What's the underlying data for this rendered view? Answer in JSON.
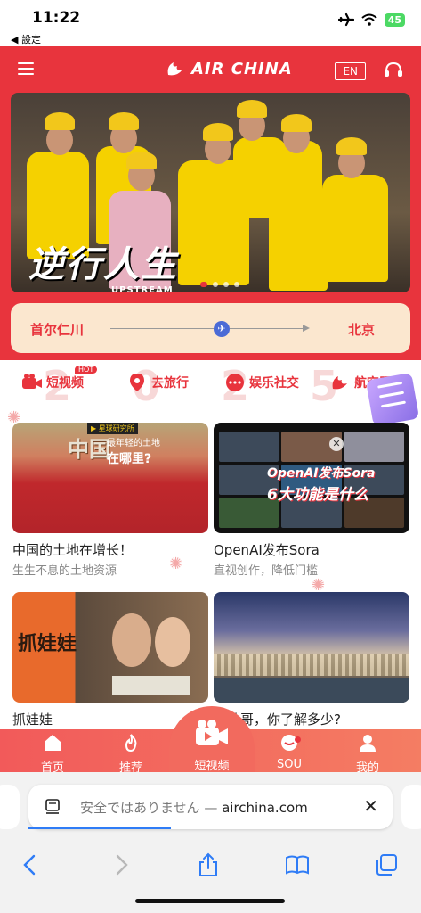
{
  "status_bar": {
    "time": "11:22",
    "back_label": "◀ 設定",
    "battery": "45"
  },
  "header": {
    "logo_text": "AIR CHINA",
    "lang_button": "EN"
  },
  "banner": {
    "title": "逆行人生",
    "subtitle": "UPSTREAM"
  },
  "route": {
    "from": "首尔仁川",
    "to": "北京"
  },
  "quick_nav": {
    "background_digits": [
      "2",
      "0",
      "2",
      "5"
    ],
    "items": [
      {
        "label": "短视频",
        "badge": "HOT"
      },
      {
        "label": "去旅行"
      },
      {
        "label": "娱乐社交"
      },
      {
        "label": "航空服务"
      }
    ]
  },
  "cards": [
    {
      "title": "中国的土地在增长！",
      "subtitle": "生生不息的土地资源",
      "thumb_text_1": "中国",
      "thumb_text_2": "最年轻的土地",
      "thumb_text_3": "在哪里?",
      "thumb_tag": "▶ 星球研究所"
    },
    {
      "title": "OpenAI发布Sora",
      "subtitle": "直视创作，降低门槛",
      "thumb_text_1": "OpenAI发布Sora",
      "thumb_text_2": "6大功能是什么"
    },
    {
      "title": "抓娃娃",
      "subtitle": "",
      "thumb_text_1": "抓娃娃"
    },
    {
      "title": "摩纳哥，你了解多少?",
      "subtitle": ""
    }
  ],
  "tabbar": {
    "items": [
      {
        "label": "首页",
        "icon": "home-icon"
      },
      {
        "label": "推荐",
        "icon": "flame-icon"
      },
      {
        "label": "短视频",
        "icon": "video-camera-icon"
      },
      {
        "label": "SOU",
        "icon": "chat-bubble-icon"
      },
      {
        "label": "我的",
        "icon": "person-icon"
      }
    ]
  },
  "safari": {
    "warning": "安全ではありません —",
    "domain": "airchina.com"
  },
  "colors": {
    "brand_red": "#e8343d",
    "route_bg": "#fbe7cf",
    "link_blue": "#2f7cf6"
  }
}
